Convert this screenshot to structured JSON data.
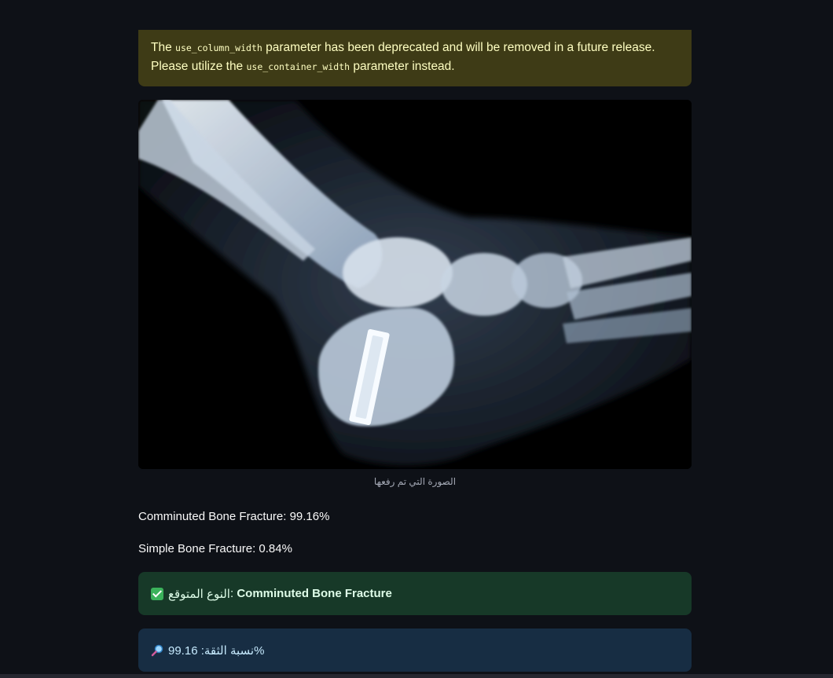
{
  "warning": {
    "text_1": "The ",
    "code_1": "use_column_width",
    "text_2": " parameter has been deprecated and will be removed in a future release. Please utilize the ",
    "code_2": "use_container_width",
    "text_3": " parameter instead."
  },
  "image": {
    "caption": "الصورة التي تم رفعها"
  },
  "probabilities": [
    {
      "text": "Comminuted Bone Fracture: 99.16%"
    },
    {
      "text": "Simple Bone Fracture: 0.84%"
    }
  ],
  "result": {
    "icon": "check-icon",
    "label": "النوع المتوقع",
    "value": "Comminuted Bone Fracture"
  },
  "confidence": {
    "icon": "magnifier-icon",
    "text": "نسبة الثقة: 99.16%"
  },
  "colors": {
    "background": "#0e1117",
    "warning_bg": "#3e3b16",
    "warning_text": "#ffffc2",
    "success_bg": "#173928",
    "success_text": "#dffde9",
    "info_bg": "#172d43",
    "info_text": "#c7ebff"
  }
}
